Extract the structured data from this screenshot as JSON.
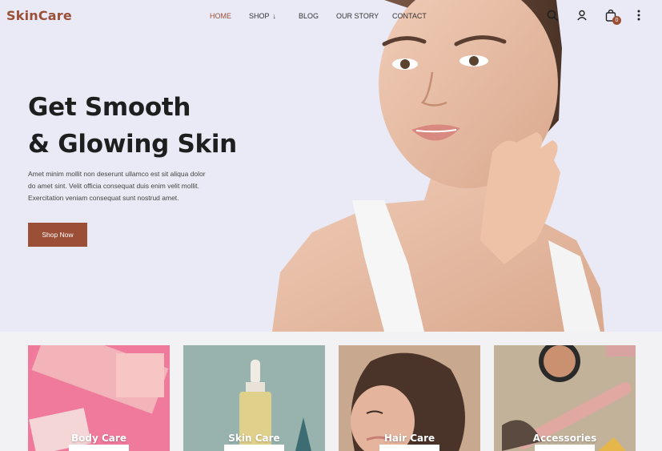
{
  "brand": {
    "name": "SkinCare",
    "accent": "#9b4f36"
  },
  "nav": {
    "items": [
      {
        "label": "HOME",
        "active": true
      },
      {
        "label": "SHOP",
        "has_dropdown": true
      },
      {
        "label": "BLOG"
      },
      {
        "label": "OUR STORY"
      },
      {
        "label": "CONTACT"
      }
    ],
    "dropdown_icon": "arrow-down-icon",
    "icons": [
      "search-icon",
      "user-icon",
      "cart-icon",
      "more-vertical-icon"
    ],
    "cart_count": "0"
  },
  "hero": {
    "title_line1": "Get Smooth",
    "title_line2": "& Glowing Skin",
    "text_line1": "Amet minim mollit non deserunt ullamco est sit aliqua dolor",
    "text_line2": "do amet sint. Velit officia consequat duis enim velit mollit.",
    "text_line3": "Exercitation veniam consequat sunt nostrud amet.",
    "button_label": "Shop Now",
    "background": "#eaeaf6"
  },
  "categories": [
    {
      "label": "Body Care",
      "color": "#f07a9c"
    },
    {
      "label": "Skin Care",
      "color": "#8aa9a4"
    },
    {
      "label": "Hair Care",
      "color": "#c8a98f"
    },
    {
      "label": "Accessories",
      "color": "#c2b29a"
    }
  ]
}
